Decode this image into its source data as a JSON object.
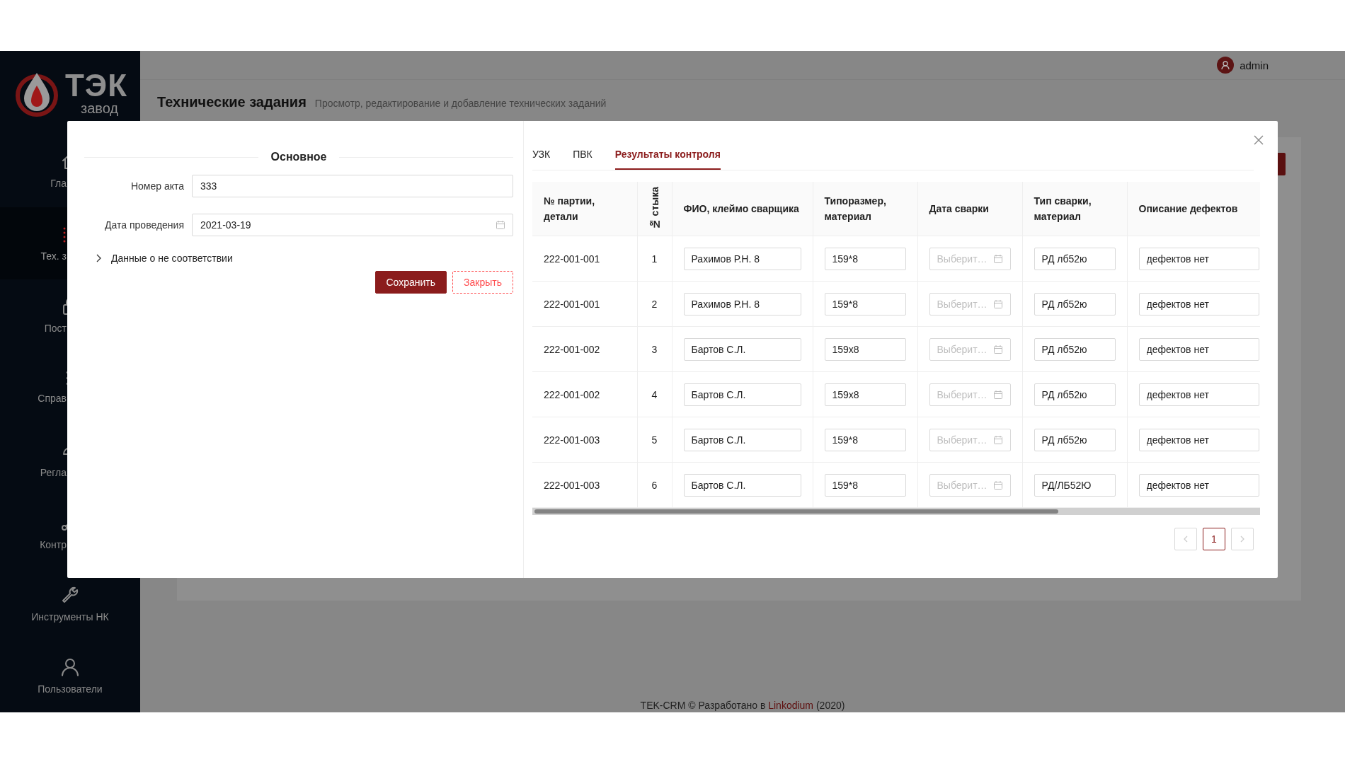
{
  "sidebar": {
    "logo": {
      "title": "ТЭК",
      "subtitle": "завод"
    },
    "items": [
      {
        "label": "Гла",
        "selected": false
      },
      {
        "label": "Тех. з",
        "selected": true
      },
      {
        "label": "Пост",
        "selected": false
      },
      {
        "label": "Справ",
        "selected": false
      },
      {
        "label": "Регла",
        "selected": false
      },
      {
        "label": "Контр",
        "selected": false
      },
      {
        "label": "Инструменты НК",
        "selected": false
      },
      {
        "label": "Пользователи",
        "selected": false
      }
    ]
  },
  "header": {
    "user": "admin"
  },
  "page": {
    "title": "Технические задания",
    "subtitle": "Просмотр, редактирование и добавление технических заданий"
  },
  "footer": {
    "prefix": "TEK-CRM © Разработано в",
    "link": "Linkodium",
    "suffix": "(2020)"
  },
  "modal": {
    "section_title": "Основное",
    "fields": [
      {
        "label": "Номер акта",
        "value": "333",
        "kind": "text"
      },
      {
        "label": "Дата проведения",
        "value": "2021-03-19",
        "kind": "date"
      }
    ],
    "collapse": {
      "label": "Данные о не соответствии",
      "expanded": false
    },
    "buttons": [
      {
        "label": "Сохранить",
        "kind": "primary"
      },
      {
        "label": "Закрыть",
        "kind": "dashed"
      }
    ],
    "tabs": [
      {
        "label": "УЗК",
        "selected": false
      },
      {
        "label": "ПВК",
        "selected": false
      },
      {
        "label": "Результаты контроля",
        "selected": true
      }
    ],
    "table": {
      "columns": [
        "№ партии, детали",
        "№ стыка",
        "ФИО, клеймо сварщика",
        "Типоразмер, материал",
        "Дата сварки",
        "Тип сварки, материал",
        "Описание дефектов"
      ],
      "rows": [
        {
          "batch": "222-001-001",
          "joint": "1",
          "welder": "Рахимов Р.Н. 8",
          "size": "159*8",
          "weld_date_placeholder": "Выберит…",
          "weld_type": "РД лб52ю",
          "defects": "дефектов нет"
        },
        {
          "batch": "222-001-001",
          "joint": "2",
          "welder": "Рахимов Р.Н. 8",
          "size": "159*8",
          "weld_date_placeholder": "Выберит…",
          "weld_type": "РД лб52ю",
          "defects": "дефектов нет"
        },
        {
          "batch": "222-001-002",
          "joint": "3",
          "welder": "Бартов С.Л.",
          "size": "159х8",
          "weld_date_placeholder": "Выберит…",
          "weld_type": "РД лб52ю",
          "defects": "дефектов нет"
        },
        {
          "batch": "222-001-002",
          "joint": "4",
          "welder": "Бартов С.Л.",
          "size": "159х8",
          "weld_date_placeholder": "Выберит…",
          "weld_type": "РД лб52ю",
          "defects": "дефектов нет"
        },
        {
          "batch": "222-001-003",
          "joint": "5",
          "welder": "Бартов С.Л.",
          "size": "159*8",
          "weld_date_placeholder": "Выберит…",
          "weld_type": "РД лб52ю",
          "defects": "дефектов нет"
        },
        {
          "batch": "222-001-003",
          "joint": "6",
          "welder": "Бартов С.Л.",
          "size": "159*8",
          "weld_date_placeholder": "Выберит…",
          "weld_type": "РД/ЛБ52Ю",
          "defects": "дефектов нет"
        }
      ]
    },
    "pagination": [
      {
        "label": "1",
        "selected": true
      }
    ]
  }
}
